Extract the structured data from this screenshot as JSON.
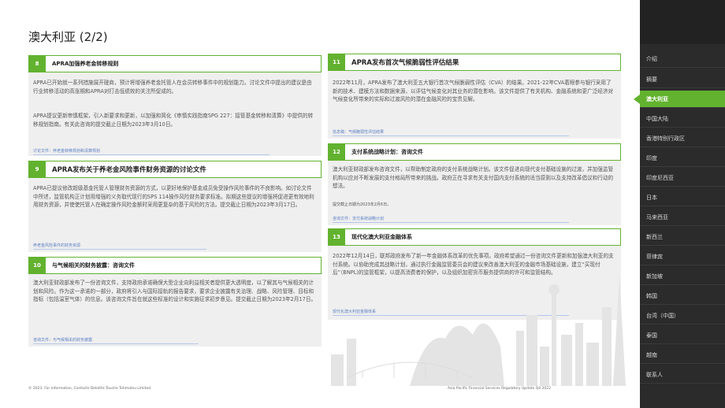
{
  "page_title": "澳大利亚 (2/2)",
  "sidebar": {
    "items": [
      {
        "label": "介绍"
      },
      {
        "label": "摘要"
      },
      {
        "label": "澳大利亚",
        "active": true
      },
      {
        "label": "中国大陆"
      },
      {
        "label": "香港特别行政区"
      },
      {
        "label": "印度"
      },
      {
        "label": "印度尼西亚"
      },
      {
        "label": "日本"
      },
      {
        "label": "马来西亚"
      },
      {
        "label": "新西兰"
      },
      {
        "label": "菲律宾"
      },
      {
        "label": "新加坡"
      },
      {
        "label": "韩国"
      },
      {
        "label": "台湾（中国）"
      },
      {
        "label": "泰国"
      },
      {
        "label": "越南"
      },
      {
        "label": "联系人"
      }
    ]
  },
  "cards": {
    "c8": {
      "number": "8",
      "title": "APRA加强养老金转移规则",
      "p1": "APRA已开始就一系列措施展开磋商，预计将增强养老金托管人在会员转移事件中的规划能力。讨论文件中提出的建议是由行业转移活动的高涨期和APRA对打击低绩效的关注所促成的。",
      "p2": "APRA提议更新审慎框架，引入新要求和更新，以加强和简化《审慎实践指南SPG 227：接管基金转移和清算》中提供的转移规划指南。有关此咨询的提交截止日期为2023年3月10日。",
      "link": "讨论文件：养老金转移规划和清算规划"
    },
    "c9": {
      "number": "9",
      "title": "APRA发布关于养老金风险事件财务资源的讨论文件",
      "p1": "APRA已提议修改超级基金托管人管理财务资源的方式，以更好地保护基金成员免受操作风险事件的不良影响。如讨论文件中所述，监管机构正计划用增强的义务取代现行的SPS 114操作风险财务要求标准。拟期这些提议的增强将促进更有效地利用财务资源，并使使托管人在确定操作风险金额时采用更复杂的基于风险的方法。提交截止日期为2023年3月17日。",
      "link": "养老金风险事件的财务资源"
    },
    "c10": {
      "number": "10",
      "title": "与气候相关的财务披露：咨询文件",
      "p1": "澳大利亚财政部发布了一份咨询文件，支持政府承诺确保大型企业向利益相关者提供更大透明度，以了解其与气候相关的计划和风险。作为这一承诺的一部分，政府将引入与国际接轨的报告要求，要求企业披露有关治理、战略、风险管理、目标和指标（包括温室气体）的信息。该咨询文件旨在就这些标准的设计和实施征求初步意见。提交截止日期为2023年2月17日。",
      "link": "咨询文件：与气候相关的财务披露"
    },
    "c11": {
      "number": "11",
      "title": "APRA发布首次气候脆弱性评估结果",
      "p1": "2022年11月，APRA发布了澳大利亚五大银行首次气候脆弱性评估（CVA）的结果。2021-22年CVA着眼参与银行采用了新的技术、建模方法和数据来源，以评估气候变化对其业务的潜在影响。该文件提供了有关机构、金融系统和更广泛经济对气候变化所带来的实际和过渡风险的潜在金融风险的宝贵见解。",
      "link": "信息稿：气候脆弱性评估结果"
    },
    "c12": {
      "number": "12",
      "title": "支付系统战略计划：咨询文件",
      "p1": "澳大利亚财政部发布咨询文件，以帮助制定政府的支付系统战略计划。该文件促进向现代支付基础设施的过渡，并加强监管机构以应对不断发展的支付格局所带来的挑战。政府正在寻求有关支付国内支付系统的适当原则以及支持改革倡议和行动的想法。",
      "p2": "提交截止日期为2023年2月6日。",
      "link": "咨询文件：支付系统战略计划"
    },
    "c13": {
      "number": "13",
      "title": "现代化澳大利亚金融体系",
      "p1": "2022年12月14日，联邦政府发布了新一年金融体系改革的优先事项。政府希望通过一份咨询文件更新和加强澳大利亚的支付系统。以协助完成其战略计划，通过执行金融监管委员会的建议来改善澳大利亚的金融市场基础设施，建立“买现付后”（BNPL)的监管框架，以提高消费者的保护，以及组织加密货币服务提供商的许可和监管结构。",
      "link": "现代化澳大利亚金融体系"
    }
  },
  "footer": {
    "left": "© 2023. For information, Contacts Deloitte Touche Tohmatsu Limited.",
    "right": "Asia Pacific Financial Services Regulatory Update Q4 2022"
  },
  "colors": {
    "accent": "#62b22f",
    "sidebar": "#2b2b2b",
    "card": "#efefef"
  }
}
